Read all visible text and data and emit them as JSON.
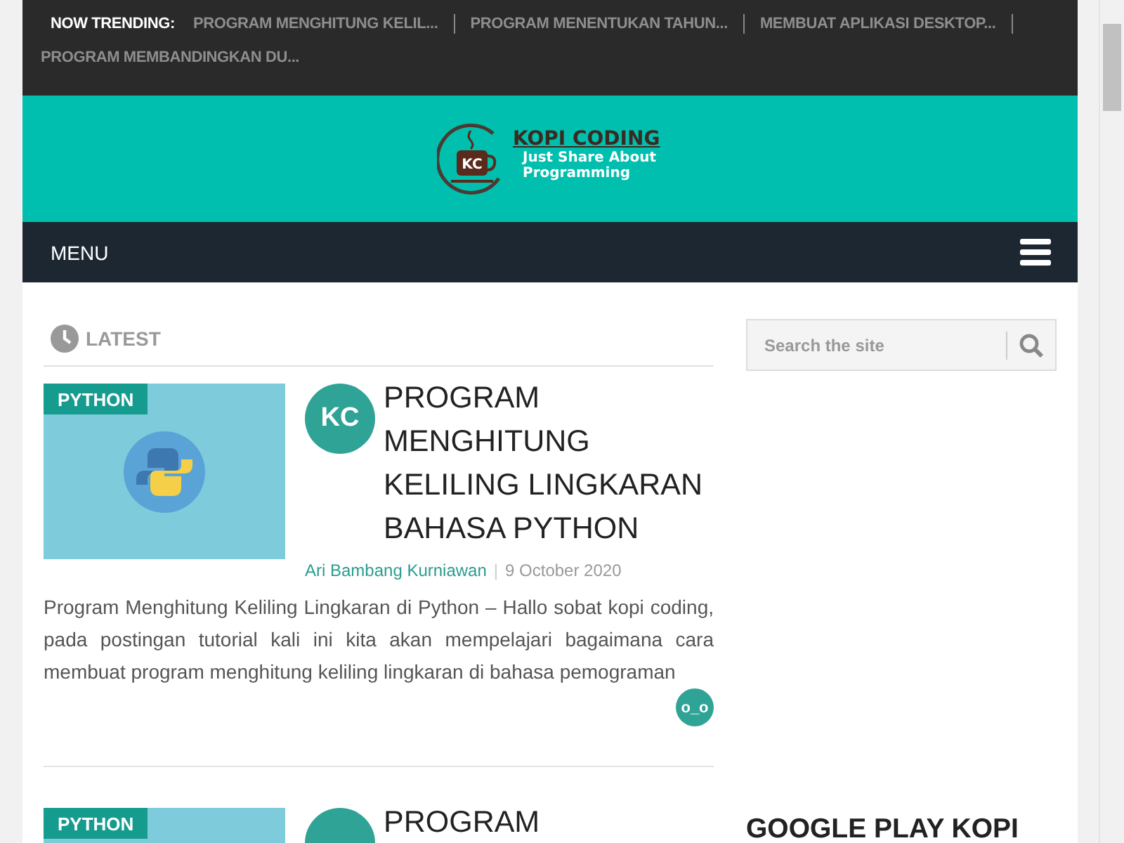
{
  "trending": {
    "label": "NOW TRENDING:",
    "items": [
      "PROGRAM MENGHITUNG KELIL...",
      "PROGRAM MENENTUKAN TAHUN...",
      "MEMBUAT APLIKASI DESKTOP...",
      "PROGRAM MEMBANDINGKAN DU..."
    ]
  },
  "header": {
    "logo_mark": "KC",
    "logo_title": "KOPI CODING",
    "logo_tagline": "Just Share About Programming"
  },
  "nav": {
    "menu_label": "MENU"
  },
  "section": {
    "title": "LATEST"
  },
  "posts": [
    {
      "category": "PYTHON",
      "avatar": "KC",
      "title": "PROGRAM MENGHITUNG KELILING LINGKARAN BAHASA PYTHON",
      "author": "Ari Bambang Kurniawan",
      "separator": "|",
      "date": "9 October 2020",
      "excerpt": "Program Menghitung Keliling Lingkaran di Python – Hallo sobat kopi coding, pada postingan tutorial kali ini kita akan mempelajari bagaimana cara membuat program menghitung keliling lingkaran di bahasa pemograman",
      "reaction": "o_o"
    },
    {
      "category": "PYTHON",
      "title": "PROGRAM"
    }
  ],
  "sidebar": {
    "search": {
      "placeholder": "Search the site"
    },
    "widget_title": "GOOGLE PLAY KOPI"
  }
}
